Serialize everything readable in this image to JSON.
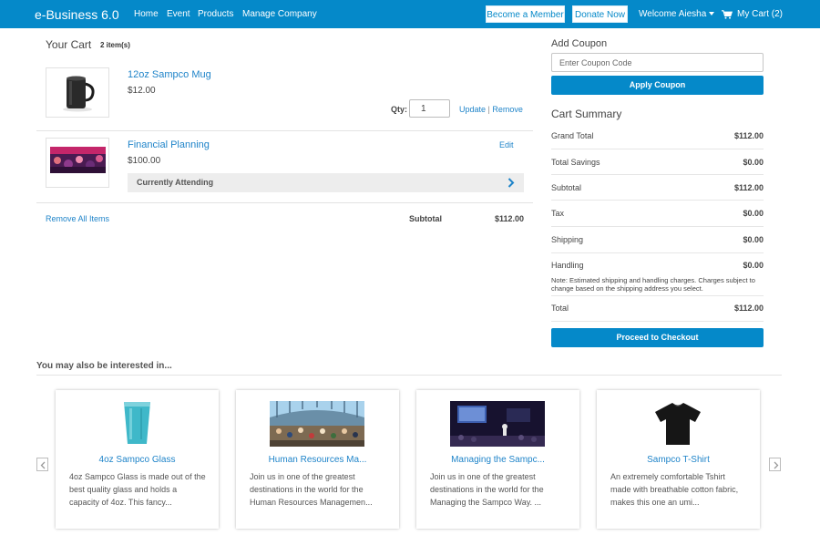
{
  "header": {
    "brand": "e-Business 6.0",
    "nav": [
      "Home",
      "Event",
      "Products",
      "Manage Company"
    ],
    "become_member": "Become a Member",
    "donate": "Donate Now",
    "welcome": "Welcome Aiesha",
    "my_cart": "My Cart (2)"
  },
  "cart": {
    "title": "Your Cart",
    "item_count": "2 item(s)",
    "items": [
      {
        "name": "12oz Sampco Mug",
        "price": "$12.00",
        "qty_label": "Qty:",
        "qty": "1",
        "update": "Update",
        "separator": "|",
        "remove": "Remove"
      },
      {
        "name": "Financial Planning",
        "price": "$100.00",
        "edit": "Edit",
        "attending": "Currently Attending"
      }
    ],
    "remove_all": "Remove All Items",
    "subtotal_label": "Subtotal",
    "subtotal_value": "$112.00"
  },
  "coupon": {
    "title": "Add Coupon",
    "placeholder": "Enter Coupon Code",
    "apply": "Apply Coupon"
  },
  "summary": {
    "title": "Cart Summary",
    "rows": [
      {
        "label": "Grand Total",
        "value": "$112.00"
      },
      {
        "label": "Total Savings",
        "value": "$0.00"
      },
      {
        "label": "Subtotal",
        "value": "$112.00"
      },
      {
        "label": "Tax",
        "value": "$0.00"
      },
      {
        "label": "Shipping",
        "value": "$0.00"
      },
      {
        "label": "Handling",
        "value": "$0.00"
      }
    ],
    "note": "Note: Estimated shipping and handling charges. Charges subject to change based on the shipping address you select.",
    "total_label": "Total",
    "total_value": "$112.00",
    "checkout": "Proceed to Checkout"
  },
  "recommendations": {
    "title": "You may also be interested in...",
    "items": [
      {
        "title": "4oz Sampco Glass",
        "desc": "4oz Sampco Glass is made out of the best quality glass and holds a capacity of 4oz. This fancy..."
      },
      {
        "title": "Human Resources Ma...",
        "desc": "Join us in one of the greatest destinations in the world for the Human Resources Managemen..."
      },
      {
        "title": "Managing the Sampc...",
        "desc": "Join us in one of the greatest destinations in the world for the Managing the Sampco Way. ..."
      },
      {
        "title": "Sampco T-Shirt",
        "desc": "An extremely comfortable Tshirt made with breathable cotton fabric, makes this one an umi..."
      }
    ]
  },
  "colors": {
    "brand_blue": "#0589c9",
    "link_blue": "#1f84c9"
  }
}
